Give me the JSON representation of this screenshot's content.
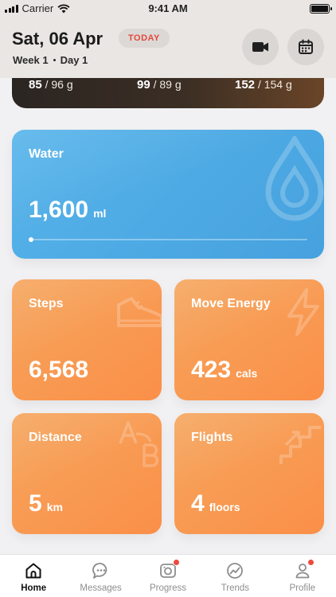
{
  "status_bar": {
    "carrier": "Carrier",
    "time": "9:41 AM"
  },
  "header": {
    "date": "Sat, 06 Apr",
    "today_badge": "TODAY",
    "week": "Week 1",
    "day": "Day 1",
    "icons": [
      "video-camera-icon",
      "calendar-icon"
    ]
  },
  "macros": [
    {
      "value": "85",
      "target": "96 g"
    },
    {
      "value": "99",
      "target": "89 g"
    },
    {
      "value": "152",
      "target": "154 g"
    }
  ],
  "water": {
    "title": "Water",
    "value": "1,600",
    "unit": "ml",
    "progress_fraction": 0.0,
    "icon": "water-drop-icon",
    "accent": "#4fa9e4"
  },
  "steps": {
    "title": "Steps",
    "value": "6,568",
    "unit": "",
    "icon": "sneaker-icon"
  },
  "move_energy": {
    "title": "Move Energy",
    "value": "423",
    "unit": "cals",
    "icon": "lightning-icon"
  },
  "distance": {
    "title": "Distance",
    "value": "5",
    "unit": "km",
    "icon": "a-to-b-icon"
  },
  "flights": {
    "title": "Flights",
    "value": "4",
    "unit": "floors",
    "icon": "stairs-icon"
  },
  "tabbar": {
    "tabs": [
      {
        "label": "Home",
        "icon": "home-icon",
        "active": true,
        "badge": false
      },
      {
        "label": "Messages",
        "icon": "chat-icon",
        "active": false,
        "badge": false
      },
      {
        "label": "Progress",
        "icon": "camera-icon",
        "active": false,
        "badge": true
      },
      {
        "label": "Trends",
        "icon": "trend-icon",
        "active": false,
        "badge": false
      },
      {
        "label": "Profile",
        "icon": "user-icon",
        "active": false,
        "badge": true
      }
    ],
    "badge_color": "#ec4a3f"
  }
}
